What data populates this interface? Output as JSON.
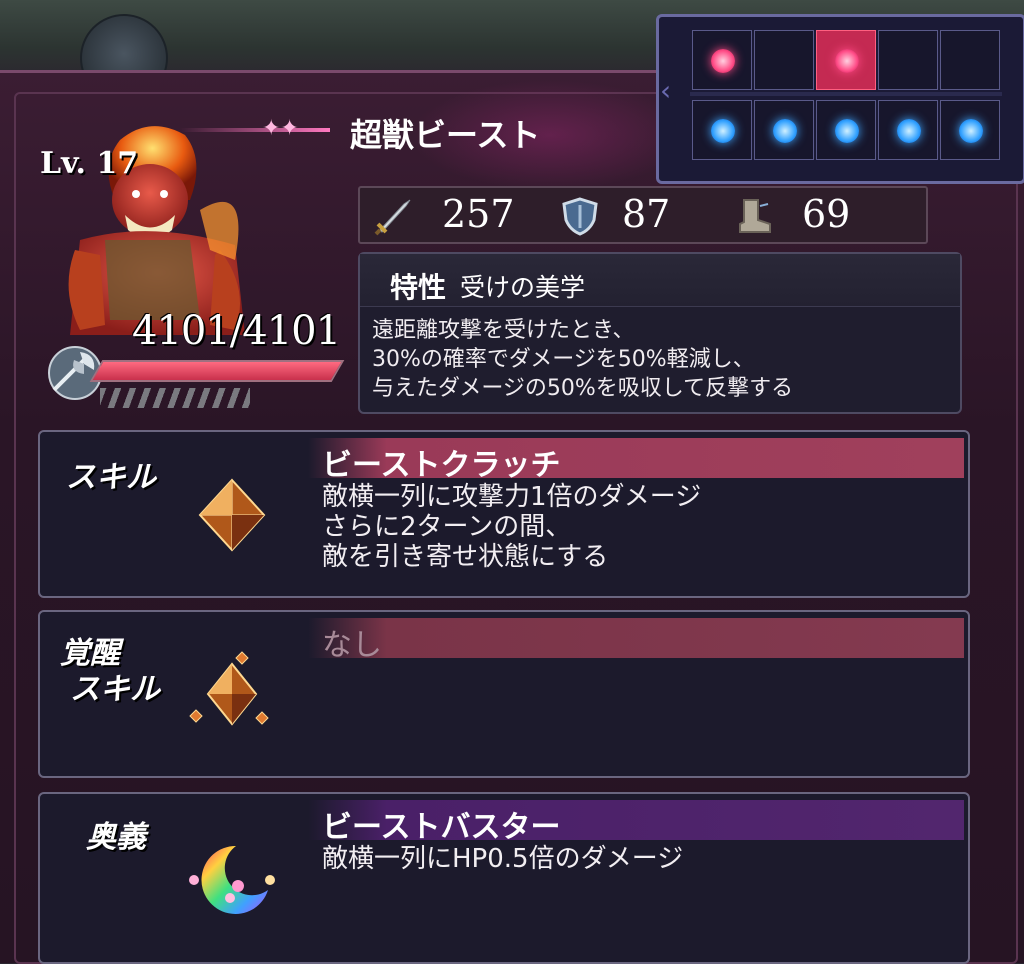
{
  "unit": {
    "name": "超獣ビースト",
    "level": "Lv. 17",
    "hp": "4101/4101",
    "hp_fraction": 1.0
  },
  "stats": {
    "attack": "257",
    "defense": "87",
    "speed": "69"
  },
  "trait": {
    "label": "特性",
    "name": "受けの美学",
    "lines": [
      "遠距離攻撃を受けたとき、",
      "30%の確率でダメージを50%軽減し、",
      "与えたダメージの50%を吸収して反撃する"
    ]
  },
  "skill": {
    "label": "スキル",
    "name": "ビーストクラッチ",
    "lines": [
      "敵横一列に攻撃力1倍のダメージ",
      "さらに2ターンの間、",
      "敵を引き寄せ状態にする"
    ]
  },
  "awakening": {
    "label_line1": "覚醒",
    "label_line2": "スキル",
    "name": "なし"
  },
  "ultimate": {
    "label": "奥義",
    "name": "ビーストバスター",
    "lines": [
      "敵横一列にHP0.5倍のダメージ"
    ]
  },
  "formation": {
    "front_row": [
      "pink",
      "empty",
      "pink-active",
      "empty",
      "empty"
    ],
    "back_row": [
      "blue",
      "blue",
      "blue",
      "blue",
      "blue"
    ]
  },
  "icons": {
    "attack": "sword-icon",
    "defense": "shield-icon",
    "speed": "boot-icon",
    "weapon": "axe-icon",
    "skill": "orange-crystal-icon",
    "awakening": "orange-crystal-cluster-icon",
    "ultimate": "rainbow-crescent-icon"
  },
  "colors": {
    "skill_bar": "#9a3a58",
    "ultimate_bar": "#4a2068",
    "hp_fill": "#ff6a80",
    "front_dot": "#ff4b86",
    "back_dot": "#30a0ff"
  }
}
